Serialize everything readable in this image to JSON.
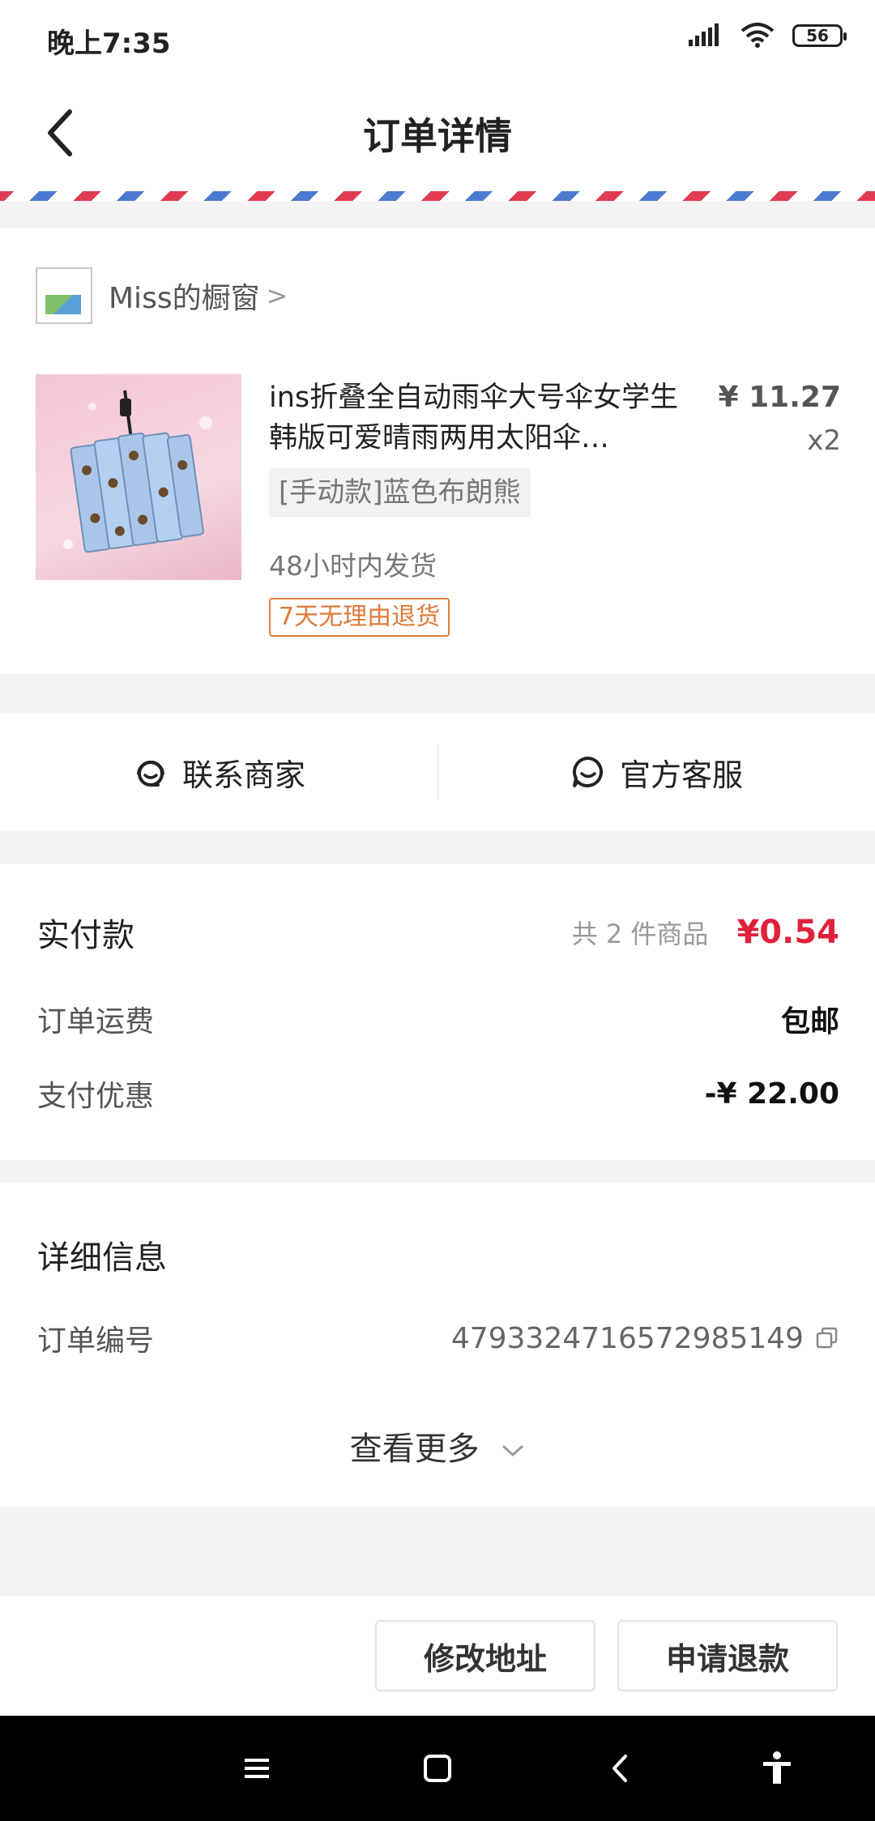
{
  "status": {
    "time": "晚上7:35",
    "battery": "56"
  },
  "header": {
    "title": "订单详情"
  },
  "shop": {
    "name": "Miss的橱窗",
    "chevron": ">"
  },
  "product": {
    "title": "ins折叠全自动雨伞大号伞女学生韩版可爱晴雨两用太阳伞…",
    "price": "¥ 11.27",
    "qty": "x2",
    "variant": "[手动款]蓝色布朗熊",
    "ship_note": "48小时内发货",
    "return_badge": "7天无理由退货"
  },
  "contact": {
    "merchant": "联系商家",
    "service": "官方客服"
  },
  "payment": {
    "paid_label": "实付款",
    "count": "共 2 件商品",
    "paid_amount": "¥0.54",
    "shipping_label": "订单运费",
    "shipping_value": "包邮",
    "discount_label": "支付优惠",
    "discount_value": "-¥ 22.00"
  },
  "details": {
    "title": "详细信息",
    "order_no_label": "订单编号",
    "order_no": "4793324716572985149",
    "more": "查看更多"
  },
  "actions": {
    "modify_address": "修改地址",
    "refund": "申请退款"
  },
  "colors": {
    "accent_red": "#e0213c",
    "badge_orange": "#e07a3a"
  }
}
